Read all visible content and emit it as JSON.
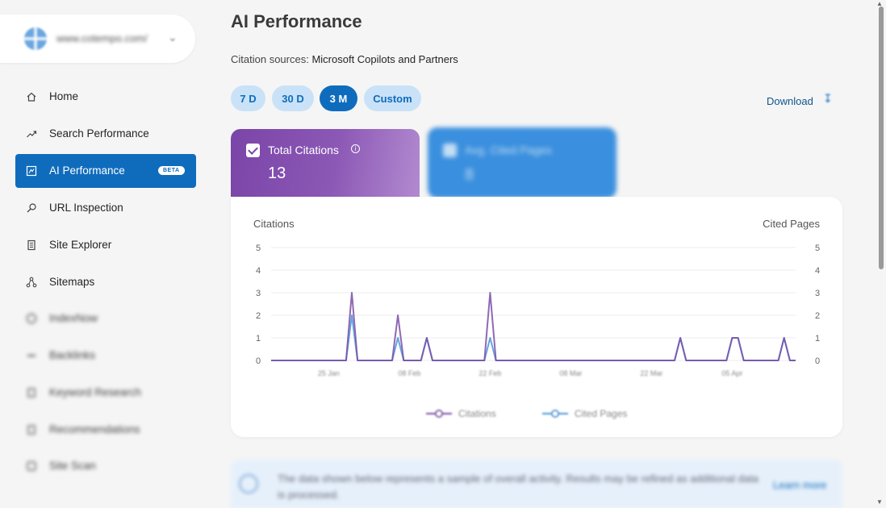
{
  "sidebar": {
    "site": {
      "url": "www.cotempo.com/"
    },
    "items": [
      {
        "label": "Home",
        "icon": "home-icon"
      },
      {
        "label": "Search Performance",
        "icon": "trend-icon"
      },
      {
        "label": "AI Performance",
        "icon": "ai-icon",
        "badge": "BETA",
        "active": true
      },
      {
        "label": "URL Inspection",
        "icon": "magnifier-icon"
      },
      {
        "label": "Site Explorer",
        "icon": "document-icon"
      },
      {
        "label": "Sitemaps",
        "icon": "sitemap-icon"
      },
      {
        "label": "IndexNow",
        "icon": "indexnow-icon"
      },
      {
        "label": "Backlinks",
        "icon": "link-icon"
      },
      {
        "label": "Keyword Research",
        "icon": "keyword-icon"
      },
      {
        "label": "Recommendations",
        "icon": "recommendations-icon"
      },
      {
        "label": "Site Scan",
        "icon": "scan-icon"
      }
    ]
  },
  "main": {
    "title": "AI Performance",
    "sources_label": "Citation sources:",
    "sources_value": "Microsoft Copilots and Partners",
    "ranges": [
      {
        "label": "7 D"
      },
      {
        "label": "30 D"
      },
      {
        "label": "3 M",
        "active": true
      },
      {
        "label": "Custom"
      }
    ],
    "download_label": "Download",
    "cards": {
      "citations": {
        "label": "Total Citations",
        "value": "13",
        "color": "#7a45a8"
      },
      "cited_pages": {
        "label": "Avg. Cited Pages",
        "value": "8",
        "color": "#3a8fde"
      }
    },
    "banner": {
      "text": "The data shown below represents a sample of overall activity. Results may be refined as additional data is processed.",
      "link": "Learn more"
    }
  },
  "chart_data": {
    "type": "line",
    "left_axis_label": "Citations",
    "right_axis_label": "Cited Pages",
    "ylim": [
      0,
      5
    ],
    "yticks": [
      0,
      1,
      2,
      3,
      4,
      5
    ],
    "xlim": [
      "2025-01-15",
      "2025-04-16"
    ],
    "xticks": [
      {
        "date": "2025-01-25",
        "label": "25 Jan"
      },
      {
        "date": "2025-02-08",
        "label": "08 Feb"
      },
      {
        "date": "2025-02-22",
        "label": "22 Feb"
      },
      {
        "date": "2025-03-08",
        "label": "08 Mar"
      },
      {
        "date": "2025-03-22",
        "label": "22 Mar"
      },
      {
        "date": "2025-04-05",
        "label": "05 Apr"
      }
    ],
    "grid": true,
    "series": [
      {
        "name": "Citations",
        "color": "#7b4fa8",
        "points": [
          [
            "2025-01-15",
            0
          ],
          [
            "2025-01-28",
            0
          ],
          [
            "2025-01-29",
            3
          ],
          [
            "2025-01-30",
            0
          ],
          [
            "2025-02-05",
            0
          ],
          [
            "2025-02-06",
            2
          ],
          [
            "2025-02-07",
            0
          ],
          [
            "2025-02-10",
            0
          ],
          [
            "2025-02-11",
            1
          ],
          [
            "2025-02-12",
            0
          ],
          [
            "2025-02-21",
            0
          ],
          [
            "2025-02-22",
            3
          ],
          [
            "2025-02-23",
            0
          ],
          [
            "2025-03-26",
            0
          ],
          [
            "2025-03-27",
            1
          ],
          [
            "2025-03-28",
            0
          ],
          [
            "2025-04-04",
            0
          ],
          [
            "2025-04-05",
            1
          ],
          [
            "2025-04-06",
            1
          ],
          [
            "2025-04-07",
            0
          ],
          [
            "2025-04-13",
            0
          ],
          [
            "2025-04-14",
            1
          ],
          [
            "2025-04-15",
            0
          ],
          [
            "2025-04-16",
            0
          ]
        ]
      },
      {
        "name": "Cited Pages",
        "color": "#4a96d8",
        "points": [
          [
            "2025-01-15",
            0
          ],
          [
            "2025-01-28",
            0
          ],
          [
            "2025-01-29",
            2
          ],
          [
            "2025-01-30",
            0
          ],
          [
            "2025-02-05",
            0
          ],
          [
            "2025-02-06",
            1
          ],
          [
            "2025-02-07",
            0
          ],
          [
            "2025-02-10",
            0
          ],
          [
            "2025-02-11",
            1
          ],
          [
            "2025-02-12",
            0
          ],
          [
            "2025-02-21",
            0
          ],
          [
            "2025-02-22",
            1
          ],
          [
            "2025-02-23",
            0
          ],
          [
            "2025-03-26",
            0
          ],
          [
            "2025-03-27",
            1
          ],
          [
            "2025-03-28",
            0
          ],
          [
            "2025-04-04",
            0
          ],
          [
            "2025-04-05",
            1
          ],
          [
            "2025-04-06",
            1
          ],
          [
            "2025-04-07",
            0
          ],
          [
            "2025-04-13",
            0
          ],
          [
            "2025-04-14",
            1
          ],
          [
            "2025-04-15",
            0
          ],
          [
            "2025-04-16",
            0
          ]
        ]
      }
    ]
  }
}
